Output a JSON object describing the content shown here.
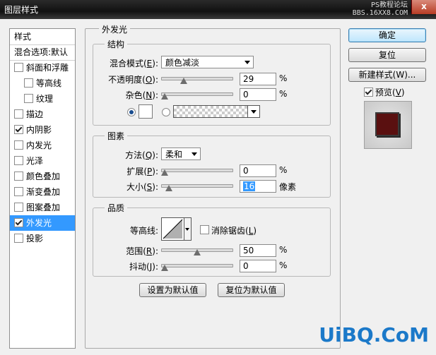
{
  "window": {
    "title": "图层样式",
    "watermark_top": "PS教程论坛\nBBS.16XX8.COM",
    "close_glyph": "x"
  },
  "sidebar": {
    "header": "样式",
    "blend_options": "混合选项:默认",
    "items": [
      {
        "label": "斜面和浮雕",
        "checked": false,
        "indent": false
      },
      {
        "label": "等高线",
        "checked": false,
        "indent": true
      },
      {
        "label": "纹理",
        "checked": false,
        "indent": true
      },
      {
        "label": "描边",
        "checked": false,
        "indent": false
      },
      {
        "label": "内阴影",
        "checked": true,
        "indent": false
      },
      {
        "label": "内发光",
        "checked": false,
        "indent": false
      },
      {
        "label": "光泽",
        "checked": false,
        "indent": false
      },
      {
        "label": "颜色叠加",
        "checked": false,
        "indent": false
      },
      {
        "label": "渐变叠加",
        "checked": false,
        "indent": false
      },
      {
        "label": "图案叠加",
        "checked": false,
        "indent": false
      },
      {
        "label": "外发光",
        "checked": true,
        "indent": false,
        "selected": true
      },
      {
        "label": "投影",
        "checked": false,
        "indent": false
      }
    ]
  },
  "panel": {
    "title": "外发光",
    "structure": {
      "title": "结构",
      "blend_mode_label": "混合模式(",
      "blend_mode_key": "E",
      "blend_mode_value": "颜色减淡",
      "opacity_label": "不透明度(",
      "opacity_key": "O",
      "opacity_value": "29",
      "opacity_fraction": 0.29,
      "noise_label": "杂色(",
      "noise_key": "N",
      "noise_value": "0",
      "noise_fraction": 0,
      "percent": "%",
      "close_paren": "):"
    },
    "elements": {
      "title": "图素",
      "method_label": "方法(",
      "method_key": "Q",
      "method_value": "柔和",
      "spread_label": "扩展(",
      "spread_key": "P",
      "spread_value": "0",
      "spread_fraction": 0,
      "size_label": "大小(",
      "size_key": "S",
      "size_value": "16",
      "size_fraction": 0.06,
      "size_unit": "像素"
    },
    "quality": {
      "title": "品质",
      "contour_label": "等高线:",
      "anti_alias_label": "消除锯齿(",
      "anti_alias_key": "L",
      "range_label": "范围(",
      "range_key": "R",
      "range_value": "50",
      "range_fraction": 0.5,
      "jitter_label": "抖动(",
      "jitter_key": "J",
      "jitter_value": "0",
      "jitter_fraction": 0
    },
    "set_default": "设置为默认值",
    "reset_default": "复位为默认值"
  },
  "buttons": {
    "ok": "确定",
    "reset": "复位",
    "new_style": "新建样式(W)...",
    "preview_label": "预览(",
    "preview_key": "V",
    "preview_close": ")"
  },
  "colors": {
    "glow_color": "#ffffff",
    "accent": "#3399ff"
  },
  "watermark_bottom": "UiBQ.CoM"
}
